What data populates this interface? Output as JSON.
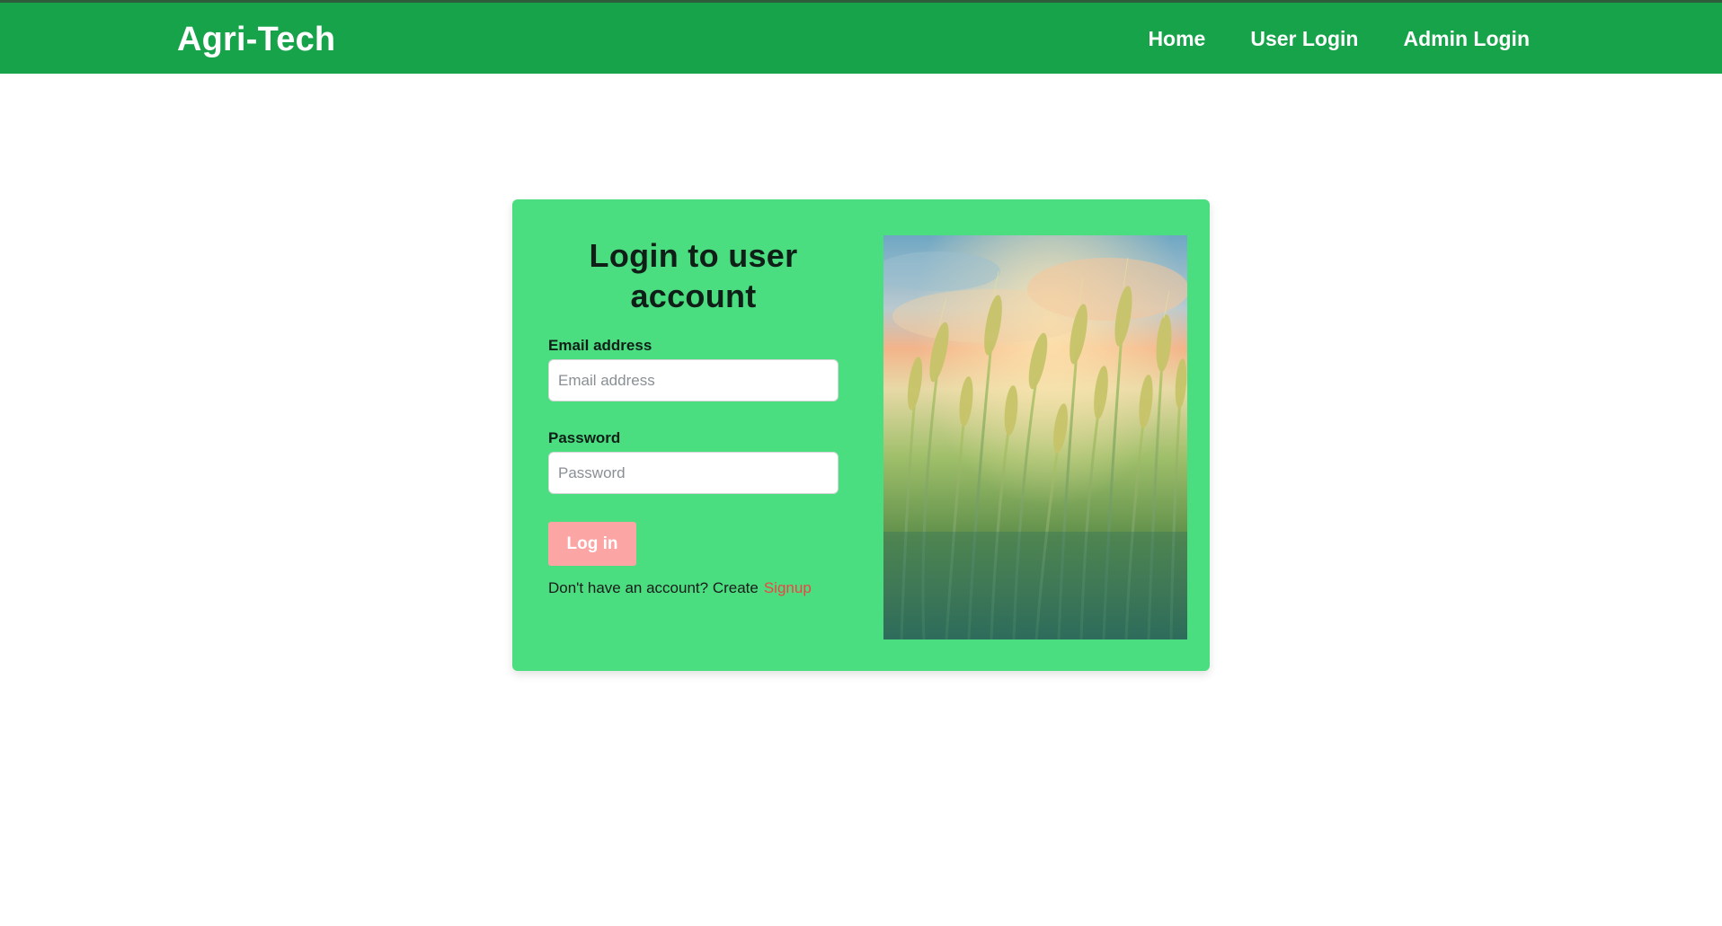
{
  "navbar": {
    "brand": "Agri-Tech",
    "links": [
      {
        "label": "Home"
      },
      {
        "label": "User Login"
      },
      {
        "label": "Admin Login"
      }
    ]
  },
  "login_card": {
    "title": "Login to user account",
    "email_label": "Email address",
    "email_placeholder": "Email address",
    "email_value": "",
    "password_label": "Password",
    "password_placeholder": "Password",
    "password_value": "",
    "login_button": "Log in",
    "signup_prompt": "Don't have an account? Create",
    "signup_link": "Signup"
  },
  "image": {
    "subject": "wheat-field-photo"
  },
  "colors": {
    "navbar": "#17a34a",
    "card": "#4ade80",
    "login_button": "#fca5a5",
    "signup_link": "#ef4444",
    "title_text": "#0f1f17"
  }
}
